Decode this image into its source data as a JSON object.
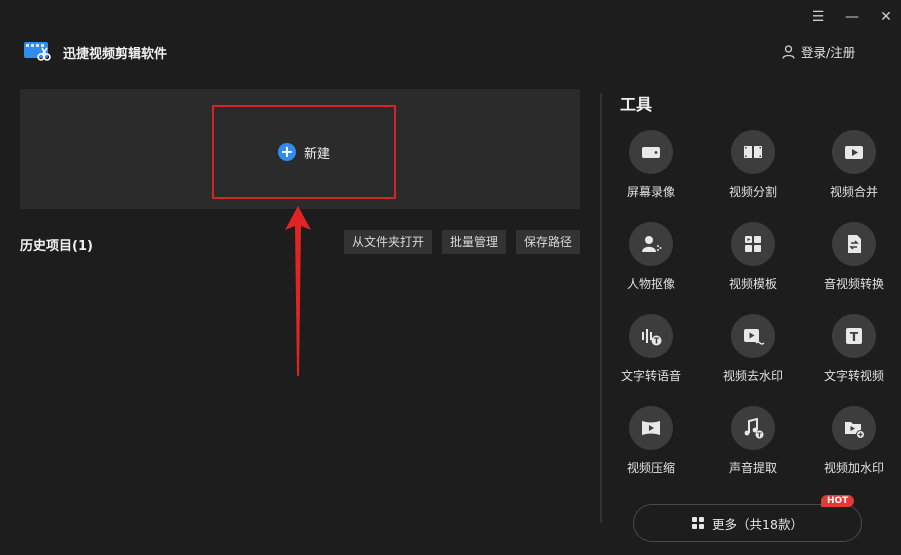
{
  "app": {
    "title": "迅捷视频剪辑软件"
  },
  "window_controls": {
    "menu": "☰",
    "minimize": "—",
    "close": "✕"
  },
  "header": {
    "login_label": "登录/注册"
  },
  "new_project": {
    "label": "新建",
    "plus": "+"
  },
  "history": {
    "title": "历史项目(1)",
    "buttons": [
      "从文件夹打开",
      "批量管理",
      "保存路径"
    ]
  },
  "tools": {
    "title": "工具",
    "items": [
      {
        "label": "屏幕录像",
        "icon": "camera-icon"
      },
      {
        "label": "视频分割",
        "icon": "film-split-icon"
      },
      {
        "label": "视频合并",
        "icon": "play-merge-icon"
      },
      {
        "label": "人物抠像",
        "icon": "person-cutout-icon"
      },
      {
        "label": "视频模板",
        "icon": "template-grid-icon"
      },
      {
        "label": "音视频转换",
        "icon": "convert-icon"
      },
      {
        "label": "文字转语音",
        "icon": "text-to-speech-icon"
      },
      {
        "label": "视频去水印",
        "icon": "remove-watermark-icon"
      },
      {
        "label": "文字转视频",
        "icon": "text-to-video-icon"
      },
      {
        "label": "视频压缩",
        "icon": "compress-icon"
      },
      {
        "label": "声音提取",
        "icon": "music-extract-icon"
      },
      {
        "label": "视频加水印",
        "icon": "add-watermark-icon"
      }
    ],
    "more_label": "更多（共18款）",
    "hot_badge": "HOT"
  },
  "colors": {
    "accent_blue": "#2f8cf0",
    "highlight_red": "#d42525",
    "background": "#1d1d1d"
  }
}
